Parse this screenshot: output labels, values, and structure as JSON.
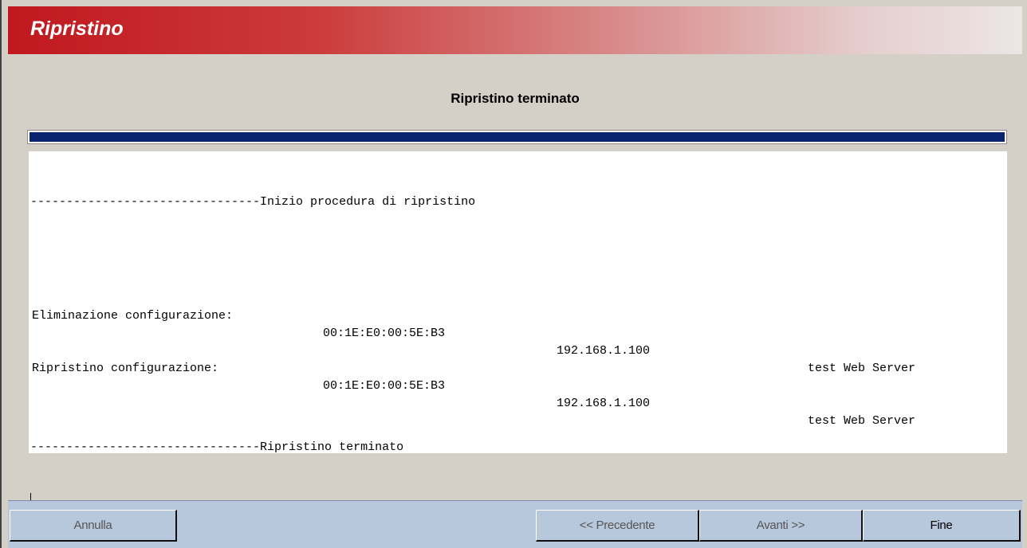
{
  "window": {
    "title": "Ripristino"
  },
  "heading": "Ripristino terminato",
  "progress": {
    "fraction": 1.0
  },
  "log": {
    "start_line": "--------------------------------Inizio procedura di ripristino",
    "rows": [
      {
        "label": "Eliminazione configurazione:",
        "mac": "00:1E:E0:00:5E:B3",
        "ip": "192.168.1.100",
        "device": "test Web Server"
      },
      {
        "label": "Ripristino configurazione:",
        "mac": "00:1E:E0:00:5E:B3",
        "ip": "192.168.1.100",
        "device": "test Web Server"
      }
    ],
    "end_line": "--------------------------------Ripristino terminato"
  },
  "buttons": {
    "cancel": "Annulla",
    "previous": "<< Precedente",
    "next": "Avanti >>",
    "finish": "Fine"
  },
  "colors": {
    "title_bar_start": "#c0181e",
    "title_bar_end": "#ebe6e4",
    "progress_fill": "#0a2470",
    "footer": "#b7c7dc",
    "window_background": "#d4d0c8"
  }
}
